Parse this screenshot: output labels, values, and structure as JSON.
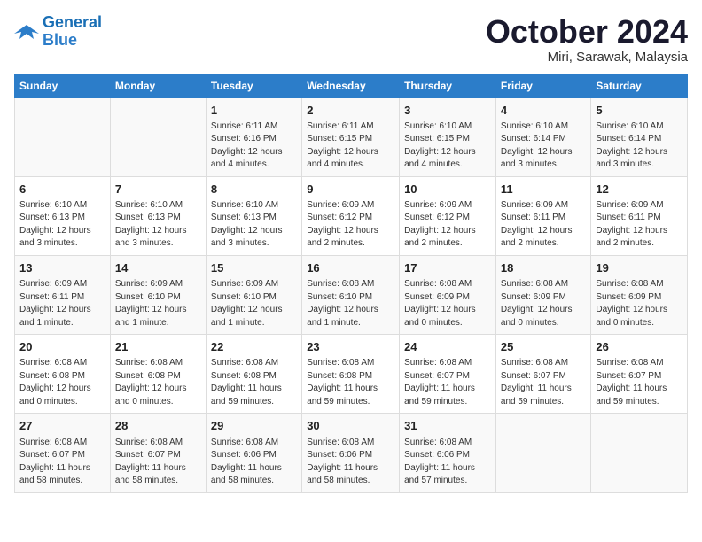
{
  "logo": {
    "line1": "General",
    "line2": "Blue"
  },
  "title": "October 2024",
  "subtitle": "Miri, Sarawak, Malaysia",
  "days_of_week": [
    "Sunday",
    "Monday",
    "Tuesday",
    "Wednesday",
    "Thursday",
    "Friday",
    "Saturday"
  ],
  "weeks": [
    [
      {
        "day": "",
        "info": ""
      },
      {
        "day": "",
        "info": ""
      },
      {
        "day": "1",
        "info": "Sunrise: 6:11 AM\nSunset: 6:16 PM\nDaylight: 12 hours\nand 4 minutes."
      },
      {
        "day": "2",
        "info": "Sunrise: 6:11 AM\nSunset: 6:15 PM\nDaylight: 12 hours\nand 4 minutes."
      },
      {
        "day": "3",
        "info": "Sunrise: 6:10 AM\nSunset: 6:15 PM\nDaylight: 12 hours\nand 4 minutes."
      },
      {
        "day": "4",
        "info": "Sunrise: 6:10 AM\nSunset: 6:14 PM\nDaylight: 12 hours\nand 3 minutes."
      },
      {
        "day": "5",
        "info": "Sunrise: 6:10 AM\nSunset: 6:14 PM\nDaylight: 12 hours\nand 3 minutes."
      }
    ],
    [
      {
        "day": "6",
        "info": "Sunrise: 6:10 AM\nSunset: 6:13 PM\nDaylight: 12 hours\nand 3 minutes."
      },
      {
        "day": "7",
        "info": "Sunrise: 6:10 AM\nSunset: 6:13 PM\nDaylight: 12 hours\nand 3 minutes."
      },
      {
        "day": "8",
        "info": "Sunrise: 6:10 AM\nSunset: 6:13 PM\nDaylight: 12 hours\nand 3 minutes."
      },
      {
        "day": "9",
        "info": "Sunrise: 6:09 AM\nSunset: 6:12 PM\nDaylight: 12 hours\nand 2 minutes."
      },
      {
        "day": "10",
        "info": "Sunrise: 6:09 AM\nSunset: 6:12 PM\nDaylight: 12 hours\nand 2 minutes."
      },
      {
        "day": "11",
        "info": "Sunrise: 6:09 AM\nSunset: 6:11 PM\nDaylight: 12 hours\nand 2 minutes."
      },
      {
        "day": "12",
        "info": "Sunrise: 6:09 AM\nSunset: 6:11 PM\nDaylight: 12 hours\nand 2 minutes."
      }
    ],
    [
      {
        "day": "13",
        "info": "Sunrise: 6:09 AM\nSunset: 6:11 PM\nDaylight: 12 hours\nand 1 minute."
      },
      {
        "day": "14",
        "info": "Sunrise: 6:09 AM\nSunset: 6:10 PM\nDaylight: 12 hours\nand 1 minute."
      },
      {
        "day": "15",
        "info": "Sunrise: 6:09 AM\nSunset: 6:10 PM\nDaylight: 12 hours\nand 1 minute."
      },
      {
        "day": "16",
        "info": "Sunrise: 6:08 AM\nSunset: 6:10 PM\nDaylight: 12 hours\nand 1 minute."
      },
      {
        "day": "17",
        "info": "Sunrise: 6:08 AM\nSunset: 6:09 PM\nDaylight: 12 hours\nand 0 minutes."
      },
      {
        "day": "18",
        "info": "Sunrise: 6:08 AM\nSunset: 6:09 PM\nDaylight: 12 hours\nand 0 minutes."
      },
      {
        "day": "19",
        "info": "Sunrise: 6:08 AM\nSunset: 6:09 PM\nDaylight: 12 hours\nand 0 minutes."
      }
    ],
    [
      {
        "day": "20",
        "info": "Sunrise: 6:08 AM\nSunset: 6:08 PM\nDaylight: 12 hours\nand 0 minutes."
      },
      {
        "day": "21",
        "info": "Sunrise: 6:08 AM\nSunset: 6:08 PM\nDaylight: 12 hours\nand 0 minutes."
      },
      {
        "day": "22",
        "info": "Sunrise: 6:08 AM\nSunset: 6:08 PM\nDaylight: 11 hours\nand 59 minutes."
      },
      {
        "day": "23",
        "info": "Sunrise: 6:08 AM\nSunset: 6:08 PM\nDaylight: 11 hours\nand 59 minutes."
      },
      {
        "day": "24",
        "info": "Sunrise: 6:08 AM\nSunset: 6:07 PM\nDaylight: 11 hours\nand 59 minutes."
      },
      {
        "day": "25",
        "info": "Sunrise: 6:08 AM\nSunset: 6:07 PM\nDaylight: 11 hours\nand 59 minutes."
      },
      {
        "day": "26",
        "info": "Sunrise: 6:08 AM\nSunset: 6:07 PM\nDaylight: 11 hours\nand 59 minutes."
      }
    ],
    [
      {
        "day": "27",
        "info": "Sunrise: 6:08 AM\nSunset: 6:07 PM\nDaylight: 11 hours\nand 58 minutes."
      },
      {
        "day": "28",
        "info": "Sunrise: 6:08 AM\nSunset: 6:07 PM\nDaylight: 11 hours\nand 58 minutes."
      },
      {
        "day": "29",
        "info": "Sunrise: 6:08 AM\nSunset: 6:06 PM\nDaylight: 11 hours\nand 58 minutes."
      },
      {
        "day": "30",
        "info": "Sunrise: 6:08 AM\nSunset: 6:06 PM\nDaylight: 11 hours\nand 58 minutes."
      },
      {
        "day": "31",
        "info": "Sunrise: 6:08 AM\nSunset: 6:06 PM\nDaylight: 11 hours\nand 57 minutes."
      },
      {
        "day": "",
        "info": ""
      },
      {
        "day": "",
        "info": ""
      }
    ]
  ]
}
